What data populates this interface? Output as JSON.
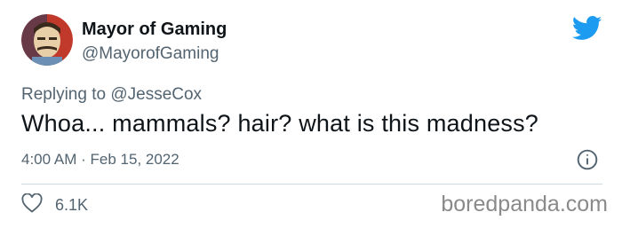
{
  "author": {
    "name": "Mayor of Gaming",
    "handle": "@MayorofGaming"
  },
  "reply": {
    "prefix": "Replying to",
    "to": "@JesseCox"
  },
  "tweet": {
    "text": "Whoa... mammals? hair? what is this madness?"
  },
  "meta": {
    "time": "4:00 AM",
    "separator": "·",
    "date": "Feb 15, 2022"
  },
  "engagement": {
    "likes": "6.1K"
  },
  "watermark": "boredpanda.com",
  "colors": {
    "twitter_blue": "#1d9bf0",
    "secondary_text": "#536471",
    "primary_text": "#0f1419",
    "divider": "#cfd9de",
    "avatar_bg": "#c0392b"
  },
  "icons": {
    "brand": "twitter-bird-icon",
    "info": "info-icon",
    "like": "heart-icon"
  }
}
